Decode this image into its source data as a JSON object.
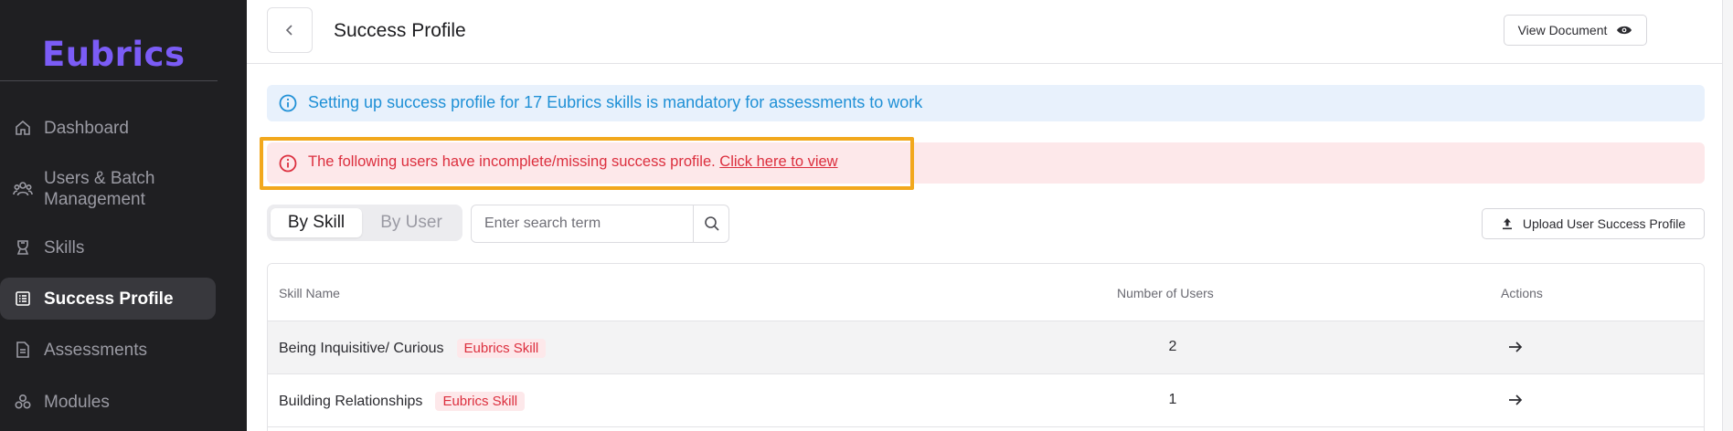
{
  "sidebar": {
    "logo": "Eubrics",
    "items": [
      {
        "label": "Dashboard",
        "icon": "home-icon"
      },
      {
        "label": "Users & Batch Management",
        "icon": "users-icon"
      },
      {
        "label": "Skills",
        "icon": "skills-icon"
      },
      {
        "label": "Success Profile",
        "icon": "list-icon",
        "active": true
      },
      {
        "label": "Assessments",
        "icon": "document-icon"
      },
      {
        "label": "Modules",
        "icon": "modules-icon"
      }
    ]
  },
  "header": {
    "title": "Success Profile",
    "view_document_label": "View Document"
  },
  "info_banner": {
    "text": "Setting up success profile for 17 Eubrics skills is mandatory for assessments to work"
  },
  "error_banner": {
    "text": "The following users have incomplete/missing success profile.",
    "link": "Click here to view"
  },
  "toolbar": {
    "tab_by_skill": "By Skill",
    "tab_by_user": "By User",
    "search_placeholder": "Enter search term",
    "upload_label": "Upload User Success Profile"
  },
  "table": {
    "columns": [
      "Skill Name",
      "Number of Users",
      "Actions"
    ],
    "rows": [
      {
        "name": "Being Inquisitive/ Curious",
        "badge": "Eubrics Skill",
        "users": "2"
      },
      {
        "name": "Building Relationships",
        "badge": "Eubrics Skill",
        "users": "1"
      }
    ]
  },
  "colors": {
    "sidebar_bg": "#1f1f22",
    "logo": "#7b5cf6",
    "info_text": "#1f90d6",
    "error_text": "#dc2f3e",
    "highlight": "#f2a81d"
  }
}
